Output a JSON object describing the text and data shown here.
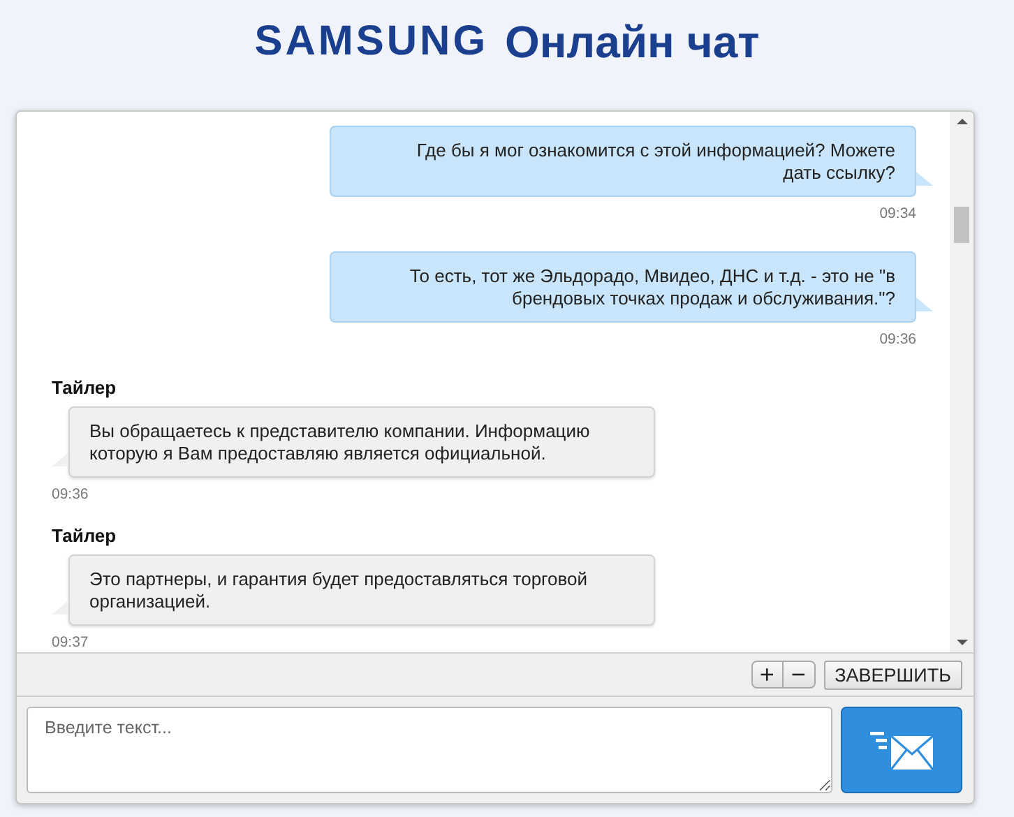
{
  "header": {
    "brand": "SAMSUNG",
    "title": "Онлайн чат"
  },
  "messages": [
    {
      "kind": "outgoing",
      "text": "Где бы я мог ознакомится с этой информацией? Можете дать ссылку?",
      "time": "09:34"
    },
    {
      "kind": "outgoing",
      "text": "То есть, тот же Эльдорадо, Мвидео, ДНС и т.д. - это не \"в брендовых точках продаж и обслуживания.\"?",
      "time": "09:36"
    },
    {
      "kind": "incoming",
      "author": "Тайлер",
      "text": "Вы обращаетесь к представителю компании. Информацию которую я Вам предоставляю является официальной.",
      "time": "09:36"
    },
    {
      "kind": "incoming",
      "author": "Тайлер",
      "text": "Это партнеры, и гарантия будет предоставляться торговой организацией.",
      "time": "09:37"
    }
  ],
  "toolbar": {
    "zoom_buttons": [
      "+",
      "−"
    ],
    "end_button": "ЗАВЕРШИТЬ"
  },
  "composer": {
    "placeholder": "Введите текст..."
  }
}
